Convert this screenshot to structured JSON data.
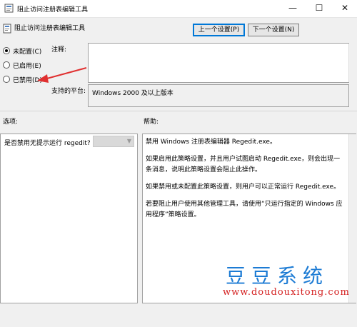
{
  "window": {
    "title": "阻止访问注册表编辑工具",
    "minimize": "—",
    "maximize": "☐",
    "close": "✕"
  },
  "header": {
    "policy_title": "阻止访问注册表编辑工具",
    "prev_button": "上一个设置(P)",
    "next_button": "下一个设置(N)"
  },
  "state": {
    "options": [
      {
        "label": "未配置(C)",
        "checked": true
      },
      {
        "label": "已启用(E)",
        "checked": false
      },
      {
        "label": "已禁用(D)",
        "checked": false
      }
    ]
  },
  "comment": {
    "label": "注释:",
    "value": ""
  },
  "platform": {
    "label": "支持的平台:",
    "value": "Windows 2000 及以上版本"
  },
  "options_pane": {
    "header": "选项:",
    "setting_label": "是否禁用无提示运行 regedit?"
  },
  "help_pane": {
    "header": "帮助:",
    "paragraphs": [
      "禁用 Windows 注册表编辑器 Regedit.exe。",
      "如果启用此策略设置，并且用户试图启动 Regedit.exe，则会出现一条消息，说明此策略设置会阻止此操作。",
      "如果禁用或未配置此策略设置，则用户可以正常运行 Regedit.exe。",
      "若要阻止用户使用其他管理工具，请使用“只运行指定的 Windows 应用程序”策略设置。"
    ]
  },
  "watermark": {
    "chinese": "豆豆系统",
    "url": "www.doudouxitong.com"
  },
  "colors": {
    "accent": "#0078d7",
    "annotation_arrow": "#e03030",
    "watermark_blue": "#1c7bd4",
    "watermark_red": "#d42020"
  }
}
